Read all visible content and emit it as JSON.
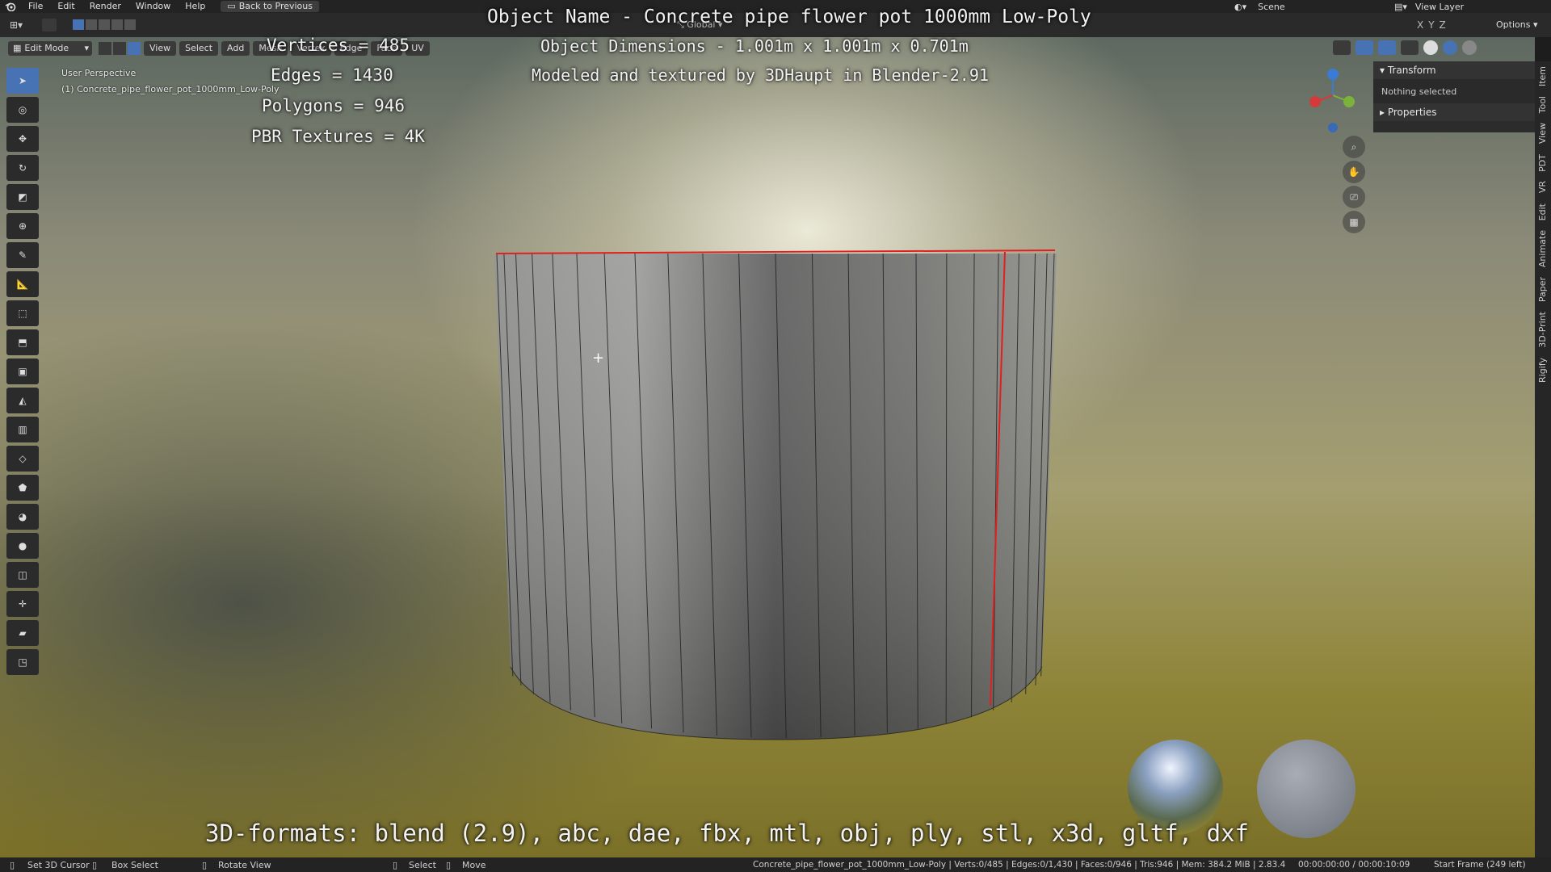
{
  "topbar": {
    "menu": [
      "File",
      "Edit",
      "Render",
      "Window",
      "Help"
    ],
    "back_button": "Back to Previous",
    "scene": "Scene",
    "view_layer": "View Layer"
  },
  "header": {
    "mode": "Edit Mode",
    "menus": [
      "View",
      "Select",
      "Add",
      "Mesh",
      "Vertex",
      "Edge",
      "Face",
      "UV"
    ],
    "orientation": "Global",
    "options": "Options"
  },
  "viewport": {
    "perspective": "User Perspective",
    "object_label": "(1) Concrete_pipe_flower_pot_1000mm_Low-Poly"
  },
  "overlay": {
    "title": "Object Name - Concrete pipe flower pot 1000mm Low-Poly",
    "dimensions": "Object Dimensions -  1.001m x 1.001m x 0.701m",
    "credit": "Modeled and textured by 3DHaupt in Blender-2.91",
    "stats": [
      "Vertices = 485",
      "Edges = 1430",
      "Polygons = 946",
      "PBR Textures = 4K"
    ],
    "formats": "3D-formats: blend (2.9), abc, dae, fbx, mtl, obj, ply, stl, x3d, gltf, dxf"
  },
  "npanel": {
    "transform": "Transform",
    "nothing_selected": "Nothing selected",
    "properties": "Properties",
    "tabs": [
      "Item",
      "Tool",
      "View",
      "PDT",
      "VR",
      "Edit",
      "Animate",
      "Paper",
      "3D-Print",
      "Rigify"
    ]
  },
  "statusbar": {
    "set_cursor": "Set 3D Cursor",
    "box_select": "Box Select",
    "rotate_view": "Rotate View",
    "select": "Select",
    "move": "Move",
    "stats": "Concrete_pipe_flower_pot_1000mm_Low-Poly | Verts:0/485 | Edges:0/1,430 | Faces:0/946 | Tris:946 | Mem: 384.2 MiB | 2.83.4",
    "time": "00:00:00:00 / 00:00:10:09",
    "frame": "Start Frame (249 left)"
  },
  "colors": {
    "accent": "#4772b3",
    "seam": "#e02020",
    "bg": "#232323"
  }
}
